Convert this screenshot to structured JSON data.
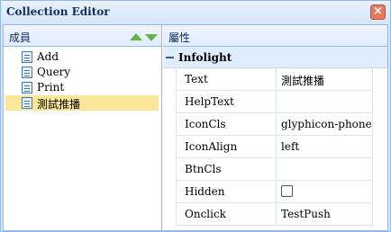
{
  "dialog": {
    "title": "Collection Editor",
    "close_glyph": "×"
  },
  "members": {
    "header": "成員",
    "move_up_icon": "up-arrow-icon",
    "move_down_icon": "down-arrow-icon",
    "items": [
      {
        "label": "Add",
        "selected": false
      },
      {
        "label": "Query",
        "selected": false
      },
      {
        "label": "Print",
        "selected": false
      },
      {
        "label": "測試推播",
        "selected": true
      }
    ]
  },
  "properties": {
    "header": "屬性",
    "group": "Infolight",
    "rows": [
      {
        "name": "Text",
        "value": "測試推播"
      },
      {
        "name": "HelpText",
        "value": ""
      },
      {
        "name": "IconCls",
        "value": "glyphicon-phone"
      },
      {
        "name": "IconAlign",
        "value": "left"
      },
      {
        "name": "BtnCls",
        "value": ""
      },
      {
        "name": "Hidden",
        "value": "",
        "checkbox": true,
        "checked": false
      },
      {
        "name": "Onclick",
        "value": "TestPush"
      }
    ]
  },
  "colors": {
    "accent": "#95b8e7",
    "selected_bg": "#fbe79a",
    "arrow": "#66b34e",
    "close": "#e8795c"
  }
}
